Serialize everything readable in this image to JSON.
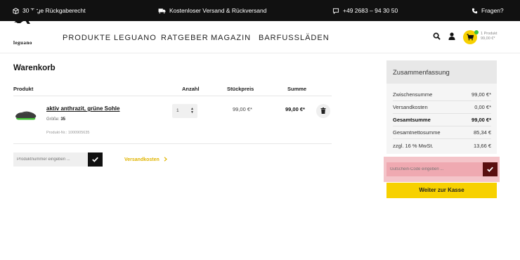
{
  "topbar": {
    "return_text": "30 Tage Rückgaberecht",
    "shipping_text": "Kostenloser Versand & Rückversand",
    "phone_text": "+49 2683 – 94 30 50",
    "questions_text": "Fragen?"
  },
  "header": {
    "logo_text": "leguano",
    "nav": [
      "PRODUKTE",
      "LEGUANO",
      "RATGEBER",
      "MAGAZIN",
      "BARFUSSLÄDEN"
    ],
    "cart_count": "1 Produkt",
    "cart_total": "99,00 €*"
  },
  "main": {
    "title": "Warenkorb",
    "columns": {
      "product": "Produkt",
      "quantity": "Anzahl",
      "unit_price": "Stückpreis",
      "total": "Summe"
    },
    "item": {
      "name": "aktiv anthrazit, grüne Sohle",
      "size_label": "Größe:",
      "size_value": "35",
      "product_nr": "Produkt-Nr.: 1000905635",
      "quantity": "1",
      "unit_price": "99,00 €*",
      "total": "99,00 €*"
    },
    "product_input_placeholder": "Produktnummer eingeben ...",
    "shipping_link": "Versandkosten"
  },
  "summary": {
    "title": "Zusammenfassung",
    "rows": [
      {
        "label": "Zwischensumme",
        "value": "99,00 €*"
      },
      {
        "label": "Versandkosten",
        "value": "0,00 €*"
      },
      {
        "label": "Gesamtsumme",
        "value": "99,00 €*"
      },
      {
        "label": "Gesamtnettosumme",
        "value": "85,34 €"
      },
      {
        "label": "zzgl. 16 % MwSt.",
        "value": "13,66 €"
      }
    ],
    "voucher_placeholder": "Gutschein-Code eingeben ...",
    "checkout_label": "Weiter zur Kasse"
  },
  "colors": {
    "accent_yellow": "#f7d100",
    "topbar_bg": "#111111",
    "voucher_highlight": "#f4c4c9",
    "cart_badge_green": "#3cc23c"
  },
  "icons": [
    "box-icon",
    "truck-icon",
    "chat-icon",
    "phone-icon",
    "search-icon",
    "account-icon",
    "cart-icon",
    "trash-icon",
    "check-icon",
    "chevron-right-icon",
    "lizard-logo"
  ]
}
